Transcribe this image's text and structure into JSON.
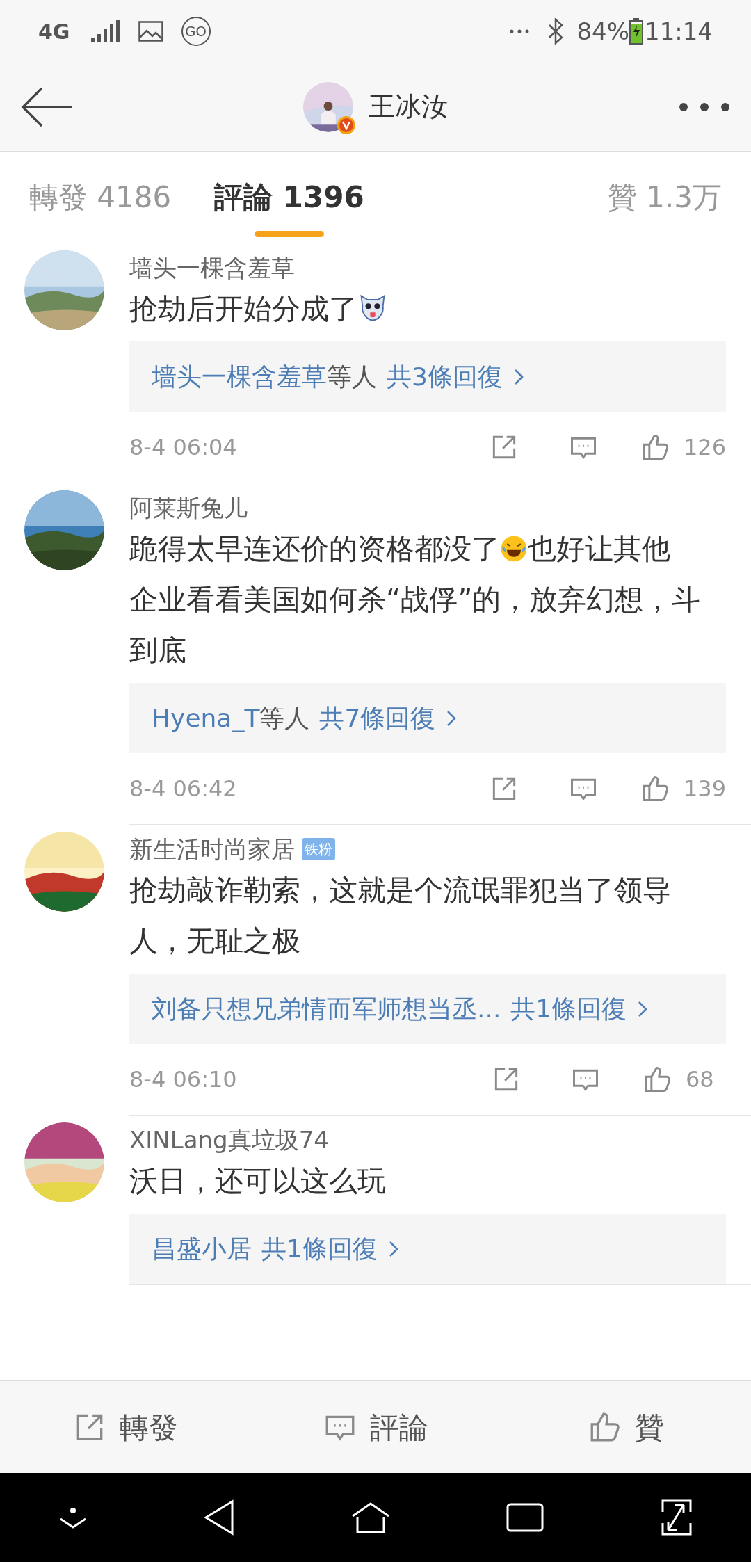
{
  "status_bar": {
    "network": "4G",
    "app_badge": "GO",
    "battery": "84%",
    "time": "11:14"
  },
  "header": {
    "title": "王冰汝",
    "verified": true
  },
  "tabs": [
    {
      "label": "轉發 4186",
      "selected": false
    },
    {
      "label": "評論 1396",
      "selected": true
    },
    {
      "label": "贊 1.3万",
      "selected": false
    }
  ],
  "comments": [
    {
      "name": "墙头一棵含羞草",
      "segments": [
        {
          "kind": "text",
          "text": "抢劫后开始分成了"
        },
        {
          "kind": "dog"
        }
      ],
      "reply": {
        "names": "墙头一棵含羞草",
        "suffix": "等人",
        "count": "共3條回復"
      },
      "time": "8-4 06:04",
      "likes": "126"
    },
    {
      "name": "阿莱斯兔儿",
      "segments": [
        {
          "kind": "text",
          "text": "跪得太早连还价的资格都没了"
        },
        {
          "kind": "laugh"
        },
        {
          "kind": "text",
          "text": "也好让其他"
        },
        {
          "kind": "paragraph",
          "text": "企业看看美国如何杀“战俘”的，放弃幻想，斗到底"
        }
      ],
      "reply": {
        "names": "Hyena_T",
        "suffix": "等人",
        "count": "共7條回復"
      },
      "time": "8-4 06:42",
      "likes": "139"
    },
    {
      "name": "新生活时尚家居",
      "badge": "铁粉",
      "segments": [
        {
          "kind": "paragraph",
          "text": "抢劫敲诈勒索，这就是个流氓罪犯当了领导人，无耻之极"
        }
      ],
      "reply": {
        "names": "刘备只想兄弟情而军师想当丞...",
        "count": "共1條回復"
      },
      "time": "8-4 06:10",
      "likes": "68"
    },
    {
      "name": "XINLang真垃圾74",
      "segments": [
        {
          "kind": "paragraph",
          "text": "沃日，还可以这么玩"
        }
      ],
      "reply": {
        "names": "昌盛小居",
        "count": "共1條回復"
      }
    }
  ],
  "actions": [
    {
      "kind": "repost",
      "label": "轉發"
    },
    {
      "kind": "comment",
      "label": "評論"
    },
    {
      "kind": "like",
      "label": "贊"
    }
  ]
}
